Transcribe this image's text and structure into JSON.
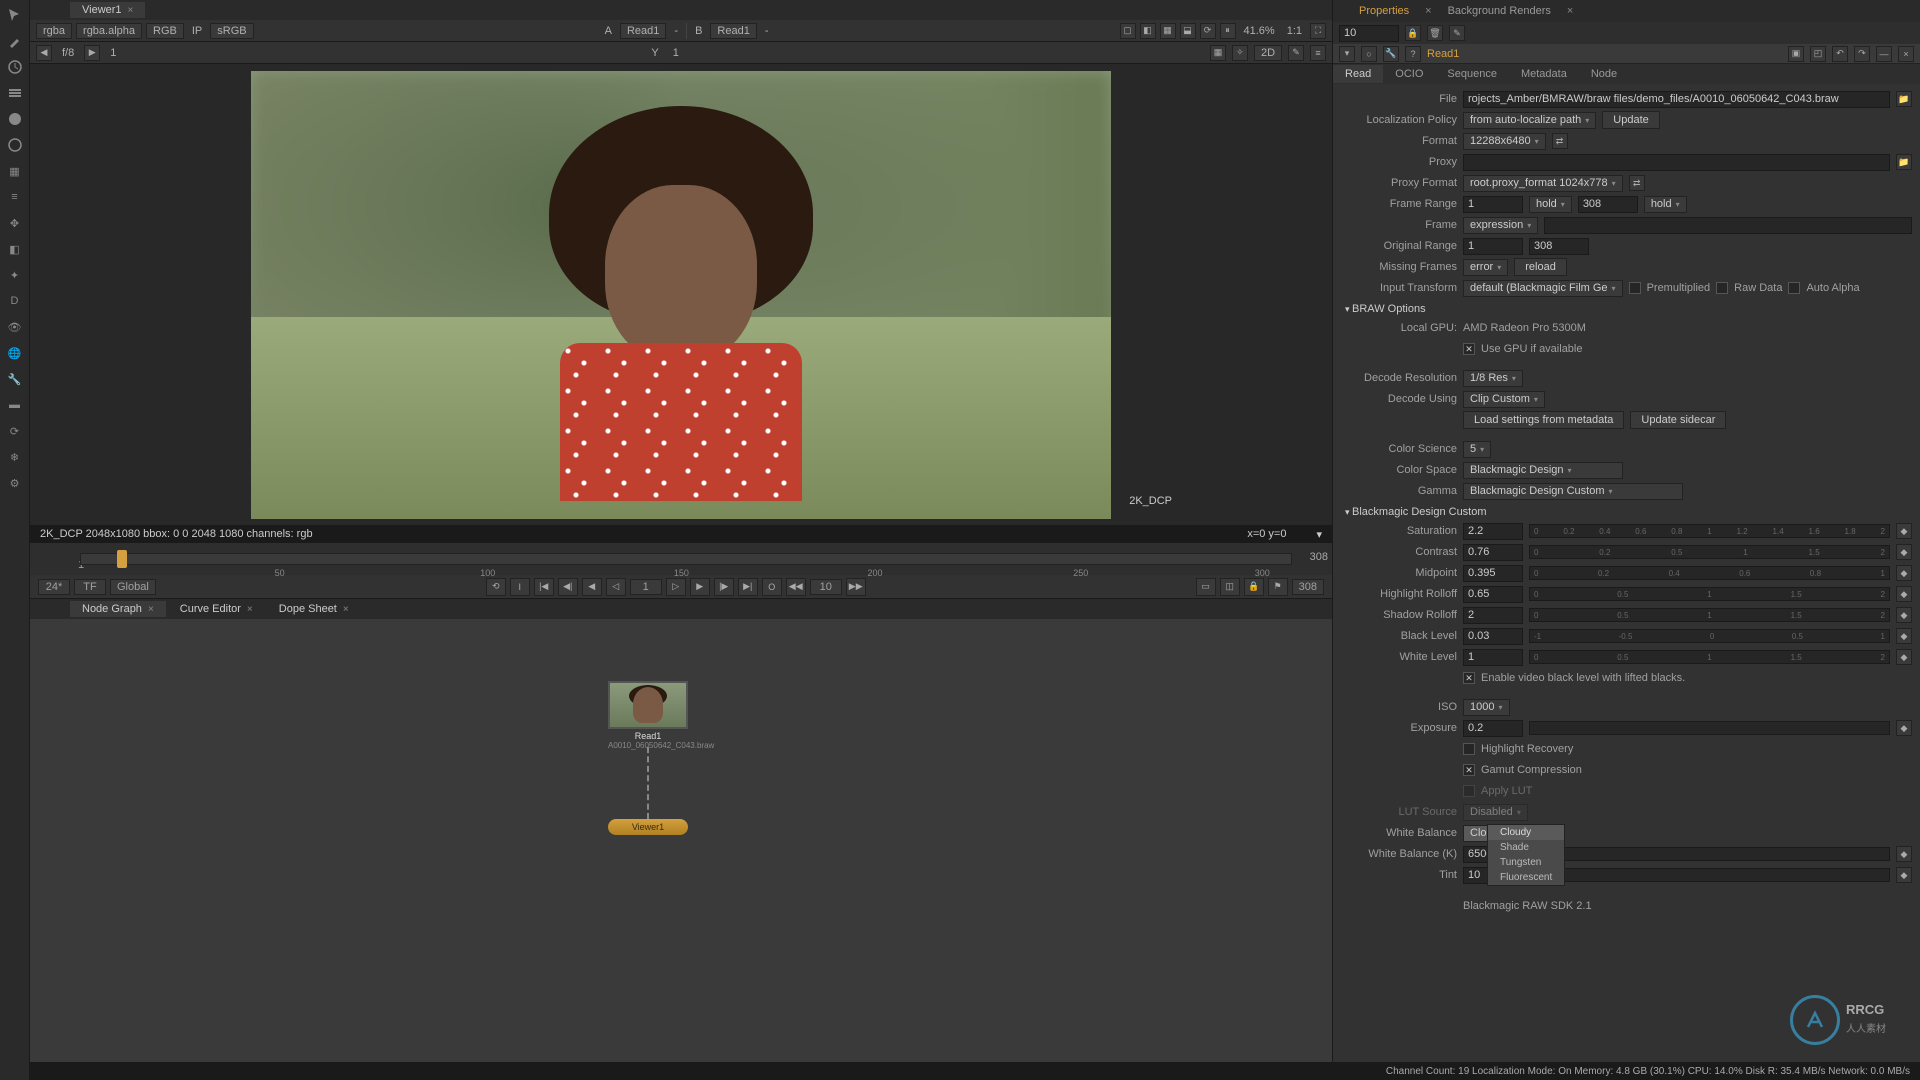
{
  "viewer": {
    "tab_name": "Viewer1",
    "channel": "rgba",
    "alpha_channel": "rgba.alpha",
    "colorspace": "RGB",
    "display": "sRGB",
    "a_input": "A",
    "a_node": "Read1",
    "b_input": "B",
    "b_node": "Read1",
    "zoom": "41.6%",
    "ratio": "1:1",
    "mode_2d": "2D",
    "fstop_label": "f/8",
    "frame_nav": "1",
    "y_label": "Y",
    "y_val": "1",
    "info_line": "2K_DCP 2048x1080  bbox: 0 0 2048 1080 channels: rgb",
    "coords": "x=0 y=0",
    "overlay_label": "2K_DCP"
  },
  "timeline": {
    "start": "1",
    "end": "308",
    "ticks": [
      "50",
      "100",
      "150",
      "200",
      "250",
      "300"
    ],
    "fps": "24*",
    "timecode": "TF",
    "range_mode": "Global",
    "current_frame": "1",
    "skip": "10",
    "out_frame": "308"
  },
  "node_graph": {
    "tabs": [
      "Node Graph",
      "Curve Editor",
      "Dope Sheet"
    ],
    "read_node": "Read1",
    "read_file": "A0010_06050642_C043.braw",
    "viewer_node": "Viewer1"
  },
  "properties": {
    "tabs": [
      "Properties",
      "Background Renders"
    ],
    "bin_count": "10",
    "node_name": "Read1",
    "subtabs": [
      "Read",
      "OCIO",
      "Sequence",
      "Metadata",
      "Node"
    ],
    "file_label": "File",
    "file_value": "rojects_Amber/BMRAW/braw files/demo_files/A0010_06050642_C043.braw",
    "localization_label": "Localization Policy",
    "localization_value": "from auto-localize path",
    "update_btn": "Update",
    "format_label": "Format",
    "format_value": "12288x6480",
    "proxy_label": "Proxy",
    "proxy_format_label": "Proxy Format",
    "proxy_format_value": "root.proxy_format 1024x778",
    "frame_range_label": "Frame Range",
    "frame_range_start": "1",
    "frame_range_end": "308",
    "hold_before": "hold",
    "hold_after": "hold",
    "frame_label": "Frame",
    "frame_value": "expression",
    "original_range_label": "Original Range",
    "original_range_start": "1",
    "original_range_end": "308",
    "missing_frames_label": "Missing Frames",
    "missing_frames_value": "error",
    "reload_btn": "reload",
    "input_transform_label": "Input Transform",
    "input_transform_value": "default (Blackmagic Film Ge",
    "premult_label": "Premultiplied",
    "rawdata_label": "Raw Data",
    "autoalpha_label": "Auto Alpha",
    "braw_section": "BRAW Options",
    "gpu_label": "Local GPU:",
    "gpu_value": "AMD Radeon Pro 5300M",
    "use_gpu_label": "Use GPU if available",
    "decode_res_label": "Decode Resolution",
    "decode_res_value": "1/8 Res",
    "decode_using_label": "Decode Using",
    "decode_using_value": "Clip Custom",
    "load_settings_btn": "Load settings from metadata",
    "update_sidecar_btn": "Update sidecar",
    "color_science_label": "Color Science",
    "color_science_value": "5",
    "color_space_label": "Color Space",
    "color_space_value": "Blackmagic Design",
    "gamma_label": "Gamma",
    "gamma_value": "Blackmagic Design Custom",
    "bdc_section": "Blackmagic Design Custom",
    "saturation_label": "Saturation",
    "saturation_value": "2.2",
    "contrast_label": "Contrast",
    "contrast_value": "0.76",
    "midpoint_label": "Midpoint",
    "midpoint_value": "0.395",
    "hl_rolloff_label": "Highlight Rolloff",
    "hl_rolloff_value": "0.65",
    "sh_rolloff_label": "Shadow Rolloff",
    "sh_rolloff_value": "2",
    "black_level_label": "Black Level",
    "black_level_value": "0.03",
    "white_level_label": "White Level",
    "white_level_value": "1",
    "video_black_label": "Enable video black level with lifted blacks.",
    "iso_label": "ISO",
    "iso_value": "1000",
    "exposure_label": "Exposure",
    "exposure_value": "0.2",
    "hl_recovery_label": "Highlight Recovery",
    "gamut_comp_label": "Gamut Compression",
    "apply_lut_label": "Apply LUT",
    "lut_source_label": "LUT Source",
    "lut_source_value": "Disabled",
    "wb_label": "White Balance",
    "wb_value": "Cloudy",
    "wb_options": [
      "Cloudy",
      "Shade",
      "Tungsten",
      "Fluorescent"
    ],
    "wbk_label": "White Balance (K)",
    "wbk_value": "6500",
    "tint_label": "Tint",
    "tint_value": "10",
    "sdk_label": "Blackmagic RAW SDK 2.1"
  },
  "status": "Channel Count: 19  Localization Mode: On  Memory: 4.8 GB (30.1%)  CPU: 14.0%  Disk R: 35.4 MB/s  Network: 0.0 MB/s",
  "watermark": {
    "big": "RRCG",
    "sub": "人人素材"
  }
}
